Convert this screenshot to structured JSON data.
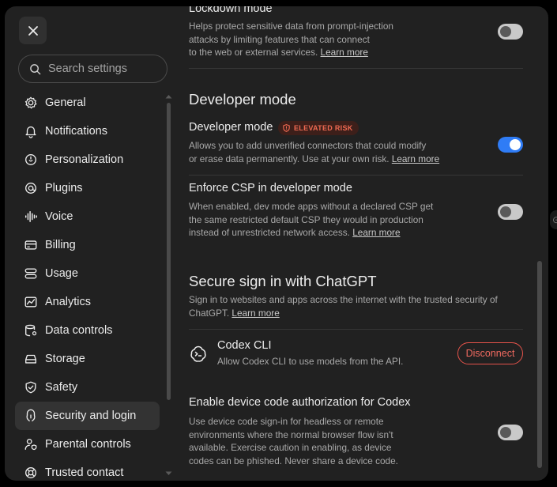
{
  "sidebar": {
    "close_label": "Close",
    "search_placeholder": "Search settings",
    "items": [
      {
        "label": "General",
        "icon": "gear-icon"
      },
      {
        "label": "Notifications",
        "icon": "bell-icon"
      },
      {
        "label": "Personalization",
        "icon": "personalization-icon"
      },
      {
        "label": "Plugins",
        "icon": "plugins-icon"
      },
      {
        "label": "Voice",
        "icon": "voice-icon"
      },
      {
        "label": "Billing",
        "icon": "billing-icon"
      },
      {
        "label": "Usage",
        "icon": "usage-icon"
      },
      {
        "label": "Analytics",
        "icon": "analytics-icon"
      },
      {
        "label": "Data controls",
        "icon": "data-controls-icon"
      },
      {
        "label": "Storage",
        "icon": "storage-icon"
      },
      {
        "label": "Safety",
        "icon": "shield-icon"
      },
      {
        "label": "Security and login",
        "icon": "security-icon",
        "active": true
      },
      {
        "label": "Parental controls",
        "icon": "parental-icon"
      },
      {
        "label": "Trusted contact",
        "icon": "lifebuoy-icon"
      }
    ]
  },
  "content": {
    "lockdown": {
      "title": "Lockdown mode",
      "desc_lines": [
        "Helps protect sensitive data from prompt-injection",
        "attacks by limiting features that can connect",
        "to the web or external services. "
      ],
      "link": "Learn more",
      "enabled": false
    },
    "developer_section_title": "Developer mode",
    "developer_mode": {
      "title": "Developer mode",
      "badge": "ELEVATED RISK",
      "desc_lines": [
        "Allows you to add unverified connectors that could modify",
        "or erase data permanently. Use at your own risk. "
      ],
      "link": "Learn more",
      "enabled": true
    },
    "enforce_csp": {
      "title": "Enforce CSP in developer mode",
      "desc_lines": [
        "When enabled, dev mode apps without a declared CSP get",
        "the same restricted default CSP they would in production",
        "instead of unrestricted network access. "
      ],
      "link": "Learn more",
      "enabled": false
    },
    "secure_signin_title": "Secure sign in with ChatGPT",
    "secure_signin": {
      "desc_lines": [
        "Sign in to websites and apps across the internet with the trusted security of",
        "ChatGPT. "
      ],
      "link": "Learn more"
    },
    "codex_cli": {
      "title": "Codex CLI",
      "desc": "Allow Codex CLI to use models from the API.",
      "button": "Disconnect"
    },
    "device_code": {
      "title": "Enable device code authorization for Codex",
      "desc_lines": [
        "Use device code sign-in for headless or remote",
        "environments where the normal browser flow isn't",
        "available. Exercise caution in enabling, as device",
        "codes can be phished. Never share a device code."
      ],
      "enabled": false
    }
  },
  "colors": {
    "modal_bg": "#212121",
    "accent_blue": "#2f7cf6",
    "danger": "#e5534b",
    "active_nav": "#333333"
  }
}
